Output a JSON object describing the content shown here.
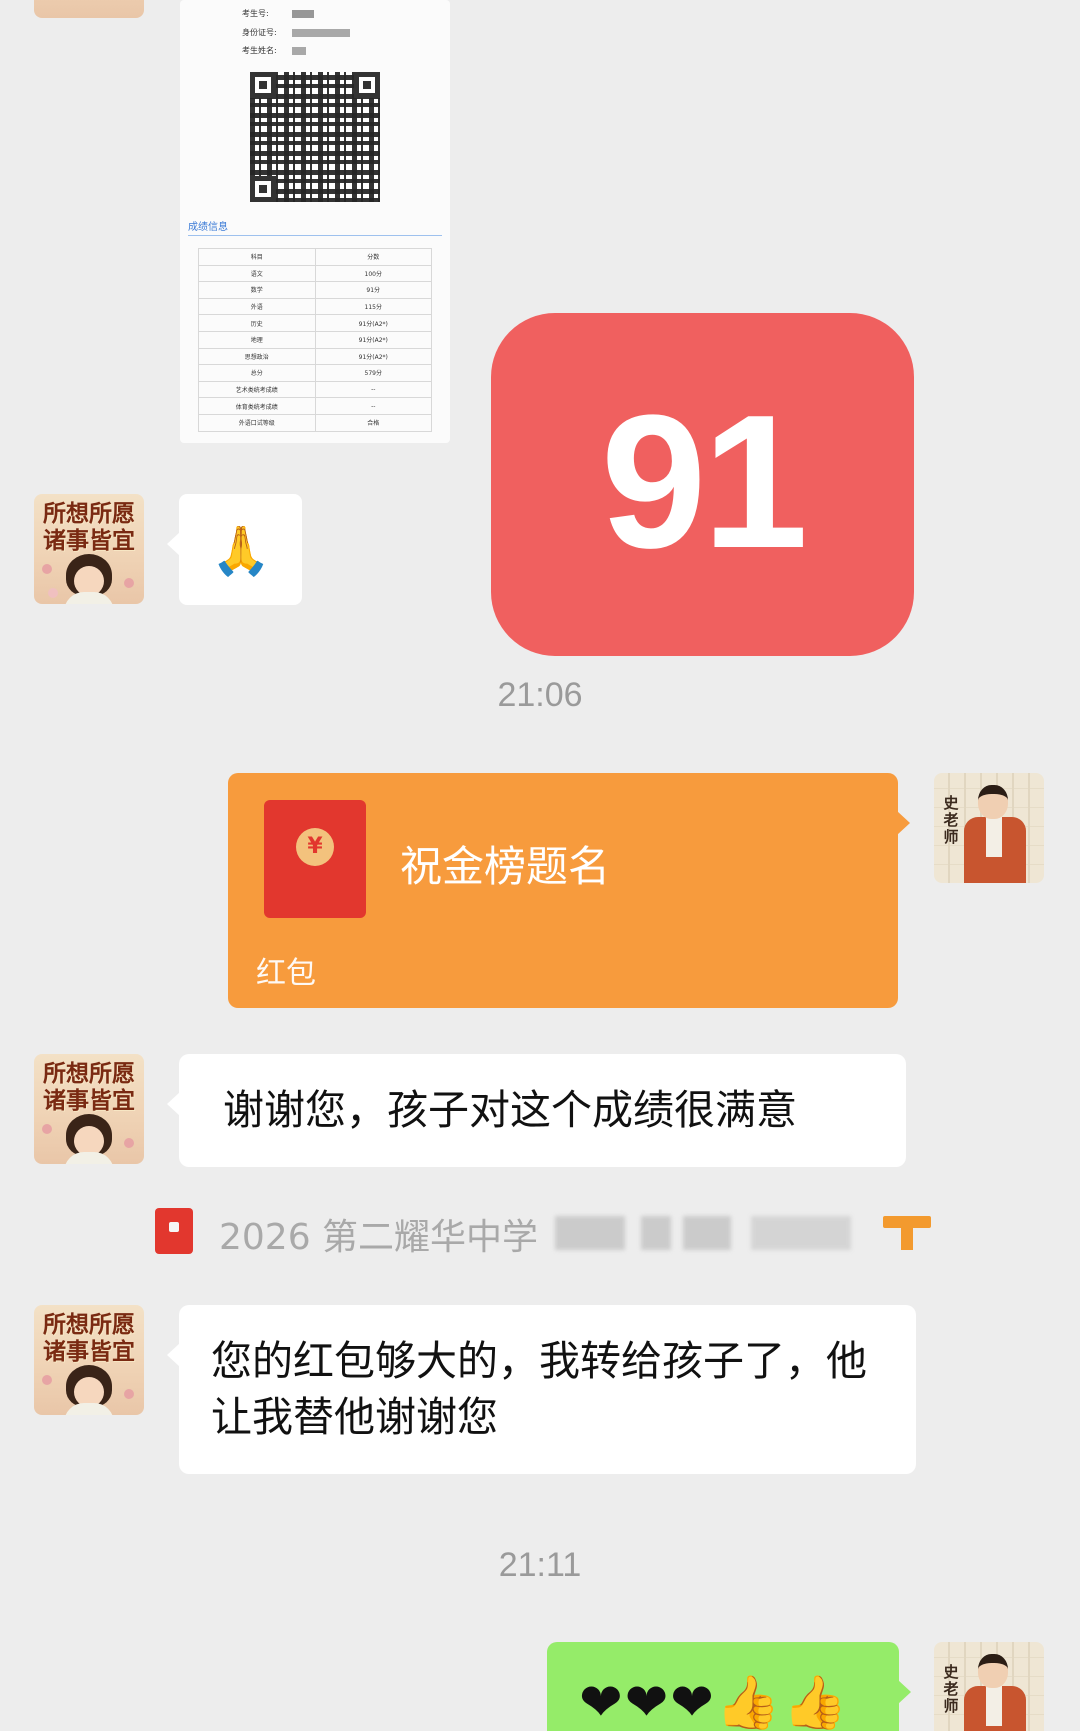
{
  "score_document": {
    "fields": [
      "考生号:",
      "身份证号:",
      "考生姓名:"
    ],
    "section_title": "成绩信息",
    "table_headers": [
      "科目",
      "分数"
    ],
    "table_rows": [
      [
        "语文",
        "100分"
      ],
      [
        "数学",
        "91分"
      ],
      [
        "外语",
        "115分"
      ],
      [
        "历史",
        "91分(A2*)"
      ],
      [
        "地理",
        "91分(A2*)"
      ],
      [
        "思想政治",
        "91分(A2*)"
      ],
      [
        "总分",
        "579分"
      ],
      [
        "艺术类统考成绩",
        "--"
      ],
      [
        "体育类统考成绩",
        "--"
      ],
      [
        "外语口试等级",
        "合格"
      ]
    ]
  },
  "sticker_score": "91",
  "messages": {
    "hands_emoji": "🙏",
    "time_1": "21:06",
    "red_packet": {
      "title": "祝金榜题名",
      "label": "红包",
      "coin_symbol": "¥"
    },
    "reply_1": "谢谢您，孩子对这个成绩很满意",
    "notice": "2026 第二耀华中学",
    "reply_2": "您的红包够大的，我转给孩子了，他让我替他谢谢您",
    "time_2": "21:11",
    "final_emojis": "❤❤❤👍👍"
  },
  "avatars": {
    "left_text": "所想所愿诸事皆宜",
    "right_text": "史老师"
  },
  "colors": {
    "background": "#ededed",
    "sticker": "#f0605f",
    "red_packet": "#f79b3d",
    "my_bubble": "#95ec69"
  }
}
